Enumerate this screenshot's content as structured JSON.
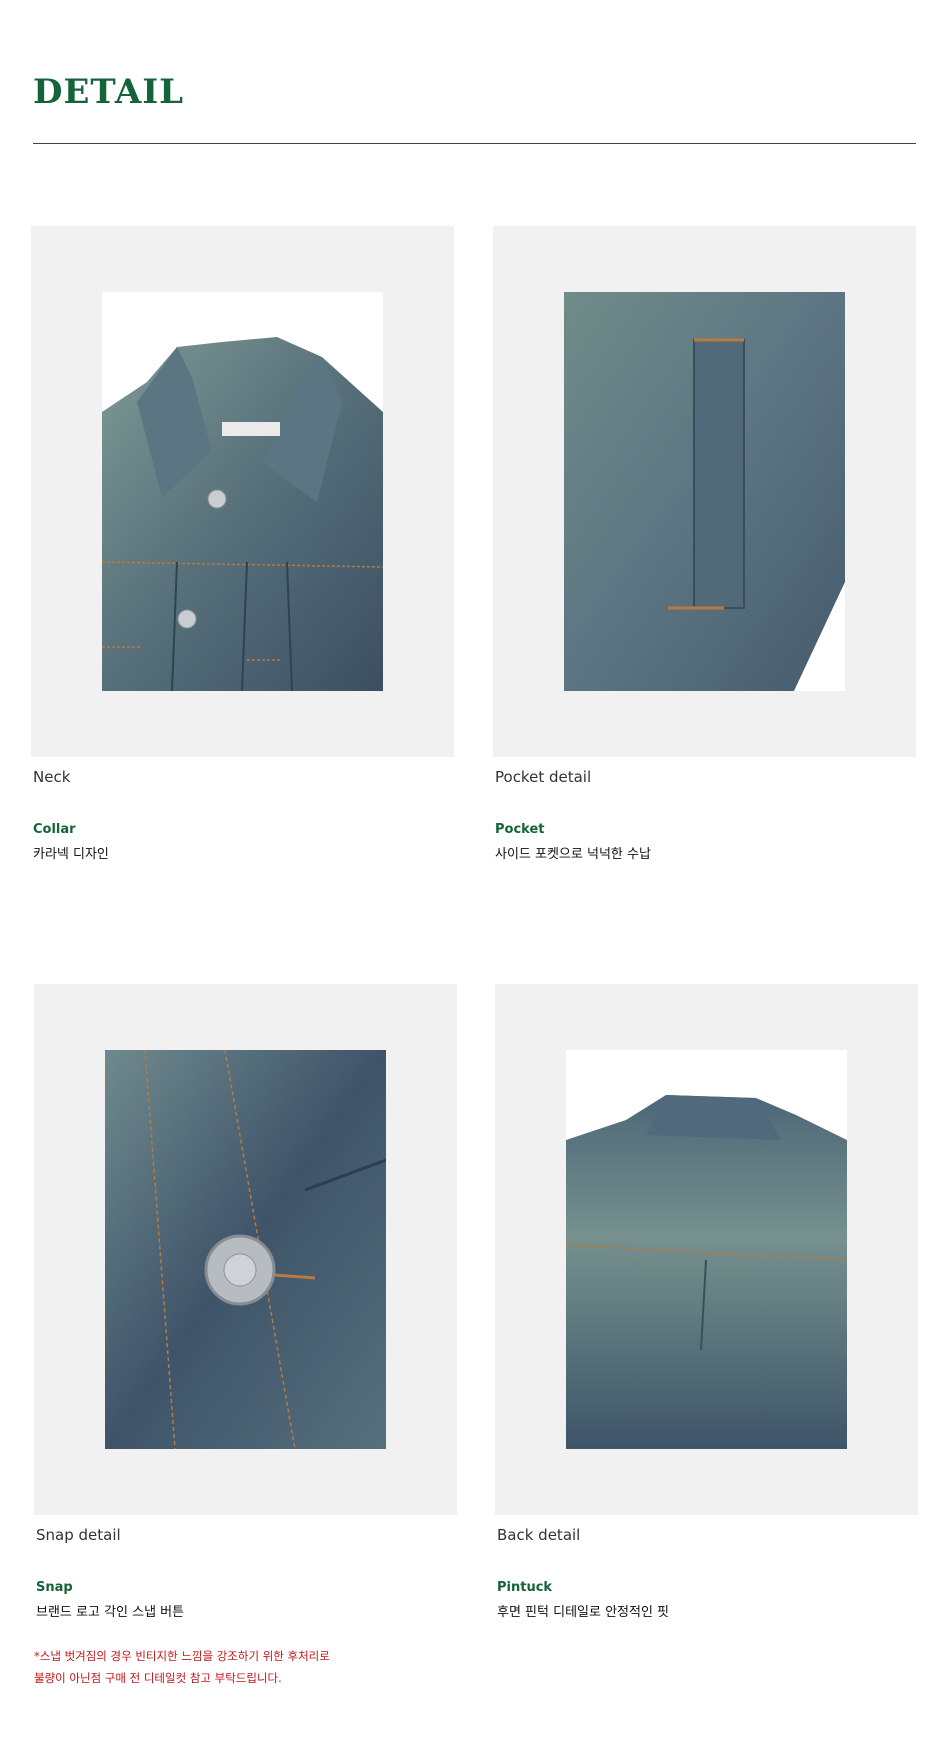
{
  "section": {
    "title": "DETAIL"
  },
  "cards": [
    {
      "caption": "Neck",
      "feature_name": "Collar",
      "feature_desc": "카라넥 디자인",
      "image_icon": "denim-collar-photo"
    },
    {
      "caption": "Pocket detail",
      "feature_name": "Pocket",
      "feature_desc": "사이드 포켓으로 넉넉한 수납",
      "image_icon": "denim-pocket-photo"
    },
    {
      "caption": "Snap detail",
      "feature_name": "Snap",
      "feature_desc": "브랜드 로고 각인 스냅 버튼",
      "image_icon": "denim-snap-photo"
    },
    {
      "caption": "Back detail",
      "feature_name": "Pintuck",
      "feature_desc": "후면 핀턱 디테일로 안정적인 핏",
      "image_icon": "denim-back-photo"
    }
  ],
  "notice": {
    "line1": "*스냅 벗겨짐의 경우 빈티지한 느낌을 강조하기 위한 후처리로",
    "line2": "불량이 아닌점 구매 전 디테일컷 참고 부탁드립니다."
  },
  "colors": {
    "accent": "#14633a",
    "notice": "#c0161b",
    "frame": "#f1f1f1",
    "denim_dark": "#3c4f62",
    "denim_light": "#7f9a95",
    "stitch": "#b87a3d"
  }
}
